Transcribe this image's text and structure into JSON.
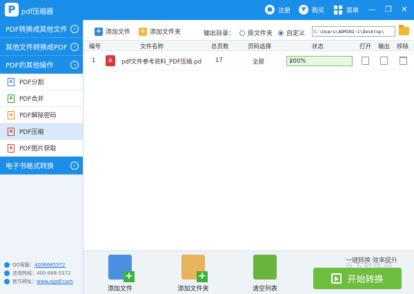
{
  "app": {
    "logo_glyph": "P",
    "title": "pdf压缩器"
  },
  "titlebar": {
    "register": "注册",
    "buy": "购买",
    "menu": "菜单",
    "register_icon": "user-icon",
    "buy_icon": "yen-icon",
    "menu_icon": "grid-icon",
    "min_glyph": "—",
    "restore_glyph": "❐",
    "close_glyph": "✕"
  },
  "sidebar": {
    "categories": [
      "PDF转换成其他文件",
      "其他文件转换成PDF",
      "PDF的其他操作",
      "电子书格式转换"
    ],
    "chev_glyph": "›",
    "items": [
      {
        "label": "PDF分割",
        "icon": "A"
      },
      {
        "label": "PDF合并",
        "icon": "A"
      },
      {
        "label": "PDF解除密码",
        "icon": "A"
      },
      {
        "label": "PDF压缩",
        "icon": "A"
      },
      {
        "label": "PDF图片获取",
        "icon": "A"
      }
    ],
    "active_item": "PDF压缩",
    "info": {
      "qq_label": "QQ客服：",
      "qq_value": "4006685572",
      "phone_label": "咨询热线：",
      "phone_value": "400-668-5572",
      "site_label": "官方网址：",
      "site_value": "www.xjpdf.com"
    }
  },
  "toolbar": {
    "add_file": "添加文件",
    "add_folder": "添加文件夹",
    "add_glyph": "+",
    "output_label": "输出目录：",
    "radio_original": "原文件夹",
    "radio_custom": "自定义",
    "selected_radio": "自定义",
    "path_value": "C:\\Users\\ADMINI~1\\Desktop\\"
  },
  "table": {
    "headers": [
      "编号",
      "文件名称",
      "总页数",
      "页码选择",
      "状态",
      "打开",
      "输出",
      "移除"
    ],
    "rows": [
      {
        "index": "1",
        "filename": "pdf文件参考资料_PDF压缩.pd",
        "pages": "17",
        "range": "全部",
        "status": "100%",
        "check": "✓"
      }
    ],
    "pdf_icon_glyph": "A"
  },
  "bottom": {
    "add_file": "添加文件",
    "add_folder": "添加文件夹",
    "clear_list": "清空列表",
    "slogan": "一键转换  效率提升",
    "watermark": "当下软件园",
    "start": "开始转换"
  },
  "colors": {
    "primary": "#1a8ee8",
    "start_button": "#6dbd3f",
    "status_border": "#7cc36f"
  }
}
